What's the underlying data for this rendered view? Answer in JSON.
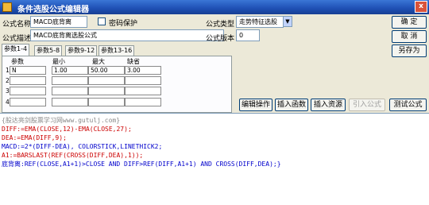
{
  "window": {
    "title": "条件选股公式编辑器",
    "close": "x"
  },
  "form": {
    "name_label": "公式名称",
    "name_value": "MACD底背离",
    "password_label": "密码保护",
    "desc_label": "公式描述",
    "desc_value": "MACD底背离选股公式",
    "type_label": "公式类型",
    "type_value": "走势特征选股",
    "version_label": "公式版本",
    "version_value": "0"
  },
  "buttons": {
    "ok": "确 定",
    "cancel": "取 消",
    "save_as": "另存为"
  },
  "tabs": [
    "参数1-4",
    "参数5-8",
    "参数9-12",
    "参数13-16"
  ],
  "params": {
    "headers": [
      "参数",
      "最小",
      "最大",
      "缺省"
    ],
    "rows": [
      {
        "num": "1",
        "name": "N",
        "min": "1.00",
        "max": "50.00",
        "default": "3.00"
      },
      {
        "num": "2",
        "name": "",
        "min": "",
        "max": "",
        "default": ""
      },
      {
        "num": "3",
        "name": "",
        "min": "",
        "max": "",
        "default": ""
      },
      {
        "num": "4",
        "name": "",
        "min": "",
        "max": "",
        "default": ""
      }
    ]
  },
  "actions": {
    "edit": "编辑操作",
    "insert_func": "插入函数",
    "insert_res": "插入资源",
    "import": "引入公式",
    "test": "测试公式"
  },
  "colors": {
    "code_fn": "#cc0000",
    "code_keyword": "#0000cc"
  },
  "code_lines": [
    "{股达亮剑股票学习网www.gutulj.com}",
    "DIFF:=EMA(CLOSE,12)-EMA(CLOSE,27);",
    "DEA:=EMA(DIFF,9);",
    "MACD:=2*(DIFF-DEA), COLORSTICK,LINETHICK2;",
    "A1:=BARSLAST(REF(CROSS(DIFF,DEA),1));",
    "底背离:REF(CLOSE,A1+1)>CLOSE AND DIFF>REF(DIFF,A1+1) AND CROSS(DIFF,DEA);}"
  ]
}
